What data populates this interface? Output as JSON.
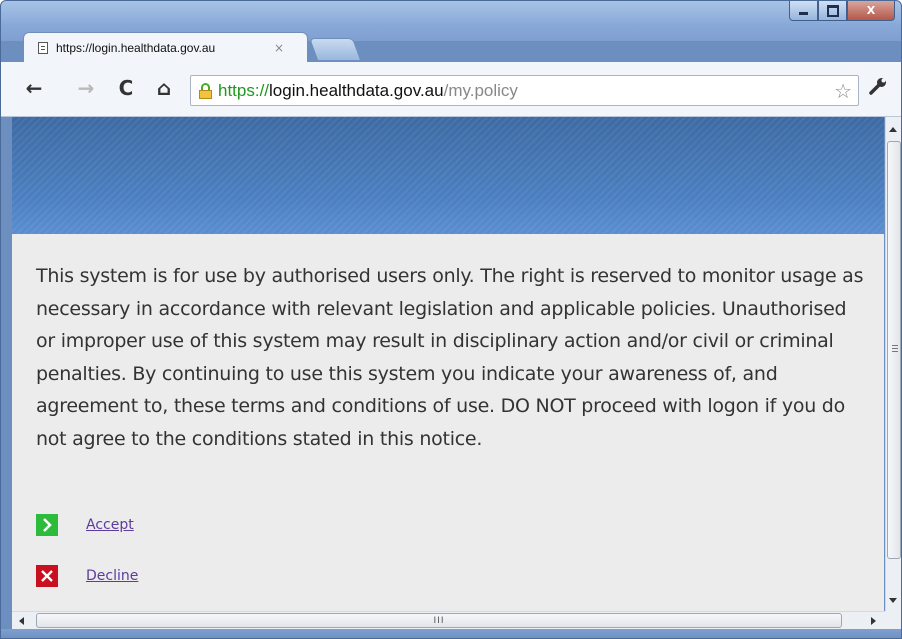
{
  "window": {
    "controls": {
      "minimize": "–",
      "maximize": "□",
      "close": "X"
    }
  },
  "tab": {
    "title": "https://login.healthdata.gov.au",
    "close": "×",
    "icon": "page-icon"
  },
  "toolbar": {
    "back": "←",
    "forward": "→",
    "reload": "C",
    "home": "⌂",
    "url": {
      "scheme": "https://",
      "host": "login.healthdata.gov.au",
      "path": "/my.policy"
    },
    "bookmark_star": "☆",
    "wrench": "🔧"
  },
  "page": {
    "notice": "This system is for use by authorised users only. The right is reserved to monitor usage as necessary in accordance with relevant legislation and applicable policies. Unauthorised or improper use of this system may result in disciplinary action and/or civil or criminal penalties. By continuing to use this system you indicate your awareness of, and agreement to, these terms and conditions of use. DO NOT proceed with logon if you do not agree to the conditions stated in this notice.",
    "accept": {
      "label": "Accept",
      "icon": "›"
    },
    "decline": {
      "label": "Decline",
      "icon": "✕"
    }
  },
  "scrollbars": {
    "h_grip": "III"
  },
  "colors": {
    "accept": "#2dbb3b",
    "decline": "#c9101e",
    "link": "#5b3c9c",
    "banner": "#4b7fc0",
    "url_scheme": "#1d9a1d"
  }
}
